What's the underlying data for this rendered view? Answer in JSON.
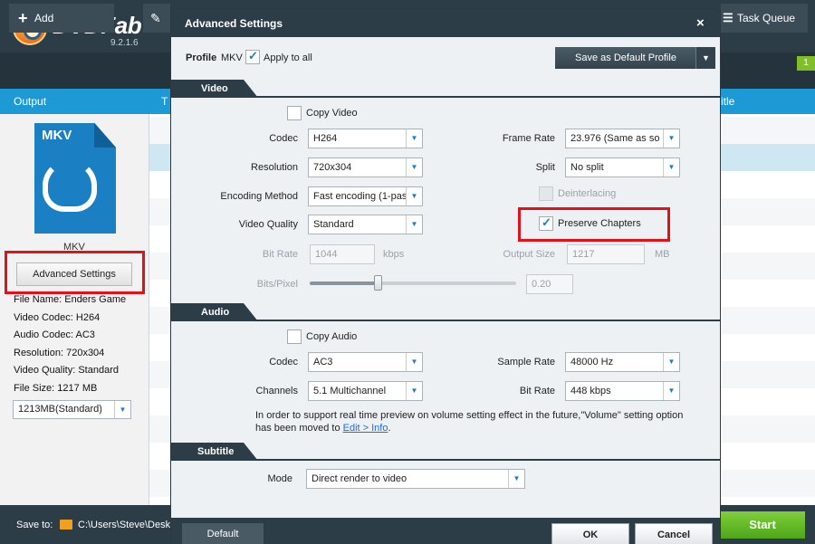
{
  "app": {
    "name": "DVDFab",
    "version": "9.2.1.6",
    "toolbar": {
      "add": "Add",
      "task_queue": "Task Queue",
      "task_count": "1"
    },
    "columns": {
      "output": "Output",
      "t": "T",
      "title": "itle"
    },
    "output_profile": {
      "format": "MKV",
      "caption": "MKV",
      "advanced_button": "Advanced Settings",
      "info": [
        "File Name: Enders Game",
        "Video Codec: H264",
        "Audio Codec: AC3",
        "Resolution: 720x304",
        "Video Quality: Standard",
        "File Size: 1217 MB"
      ],
      "size_select": "1213MB(Standard)"
    },
    "bottom": {
      "save_to_label": "Save to:",
      "path": "C:\\Users\\Steve\\Desk",
      "start": "Start"
    },
    "window_controls": {
      "menu": "▼",
      "minimize": "━",
      "maximize": "□",
      "close": "✕"
    }
  },
  "dialog": {
    "title": "Advanced Settings",
    "close": "×",
    "profile_label": "Profile",
    "profile_value": "MKV",
    "apply_to_all": "Apply to all",
    "apply_to_all_checked": true,
    "save_default_button": "Save as Default Profile",
    "video": {
      "section": "Video",
      "copy_video": "Copy Video",
      "codec_label": "Codec",
      "codec": "H264",
      "resolution_label": "Resolution",
      "resolution": "720x304",
      "encoding_label": "Encoding Method",
      "encoding": "Fast encoding (1-pas",
      "quality_label": "Video Quality",
      "quality": "Standard",
      "bitrate_label": "Bit Rate",
      "bitrate": "1044",
      "bitrate_unit": "kbps",
      "bitspixel_label": "Bits/Pixel",
      "bitspixel": "0.20",
      "framerate_label": "Frame Rate",
      "framerate": "23.976 (Same as so",
      "split_label": "Split",
      "split": "No split",
      "deinterlacing": "Deinterlacing",
      "preserve_chapters": "Preserve Chapters",
      "preserve_chapters_checked": true,
      "outputsize_label": "Output Size",
      "outputsize": "1217",
      "outputsize_unit": "MB",
      "bitspixel_slider_fraction": 0.33
    },
    "audio": {
      "section": "Audio",
      "copy_audio": "Copy Audio",
      "codec_label": "Codec",
      "codec": "AC3",
      "channels_label": "Channels",
      "channels": "5.1 Multichannel",
      "samplerate_label": "Sample Rate",
      "samplerate": "48000 Hz",
      "bitrate_label": "Bit Rate",
      "bitrate": "448 kbps",
      "note": "In order to support real time preview on volume setting effect in the future,\"Volume\" setting option has been moved to ",
      "note_link": "Edit > Info",
      "note_end": "."
    },
    "subtitle": {
      "section": "Subtitle",
      "mode_label": "Mode",
      "mode": "Direct render to video"
    },
    "buttons": {
      "default": "Default",
      "ok": "OK",
      "cancel": "Cancel"
    }
  },
  "colors": {
    "accent_blue": "#1d9ad6",
    "highlight_red": "#e0111b",
    "start_green": "#5db822",
    "dark": "#2d3d47"
  }
}
